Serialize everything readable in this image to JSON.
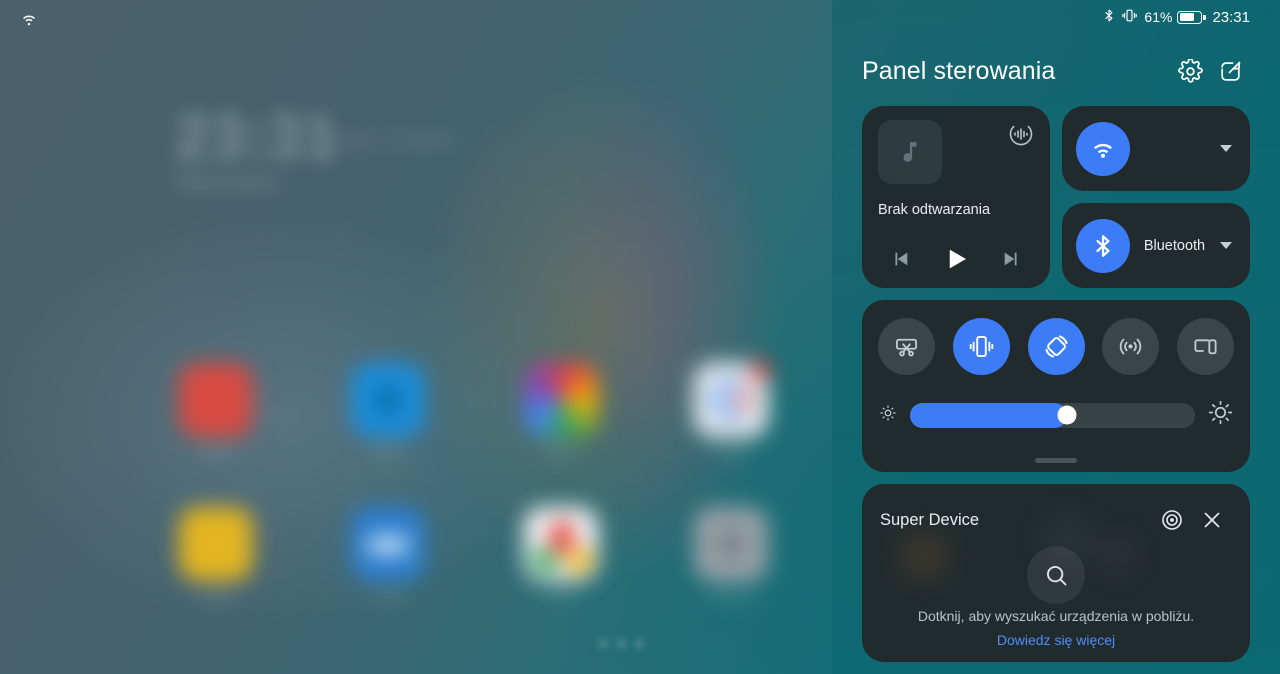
{
  "statusbar": {
    "bluetooth_icon": "bluetooth-icon",
    "vibrate_icon": "vibrate-icon",
    "battery_percent": "61%",
    "battery_level": 61,
    "clock": "23:31"
  },
  "homescreen": {
    "wifi_icon": "wifi-icon",
    "clock_big": "23:31",
    "clock_sub": "Warszawa",
    "clock_side": "środa, 6 marca",
    "apps": [
      {
        "label": "Telefon",
        "color": "#d94a42",
        "badge": false
      },
      {
        "label": "Skype",
        "color": "#1a8fdd",
        "badge": false
      },
      {
        "label": "Zdjęcia",
        "color": "#d8a020",
        "badge": false
      },
      {
        "label": "Google",
        "color": "#dedede",
        "badge": true
      },
      {
        "label": "Notatki",
        "color": "#e3b521",
        "badge": false
      },
      {
        "label": "Poczta",
        "color": "#2b7fd0",
        "badge": false
      },
      {
        "label": "Mapy",
        "color": "#ebeef0",
        "badge": false
      },
      {
        "label": "Ustawienia",
        "color": "#8b9499",
        "badge": false
      }
    ]
  },
  "panel": {
    "title": "Panel sterowania",
    "settings_icon": "gear-icon",
    "edit_icon": "edit-icon"
  },
  "media": {
    "album_art_icon": "music-note-icon",
    "cast_icon": "audio-output-icon",
    "title": "Brak odtwarzania",
    "previous_icon": "skip-previous-icon",
    "play_icon": "play-icon",
    "next_icon": "skip-next-icon"
  },
  "connectivity": [
    {
      "name": "wifi",
      "label": "",
      "icon": "wifi-icon",
      "active": true,
      "chevron_icon": "chevron-down-icon"
    },
    {
      "name": "bluetooth",
      "label": "Bluetooth",
      "icon": "bluetooth-icon",
      "active": true,
      "chevron_icon": "chevron-down-icon"
    }
  ],
  "toggles": [
    {
      "name": "screenshot",
      "icon": "screenshot-scissors-icon",
      "active": false
    },
    {
      "name": "vibrate",
      "icon": "vibrate-icon",
      "active": true
    },
    {
      "name": "rotation-lock",
      "icon": "rotation-lock-icon",
      "active": true
    },
    {
      "name": "hotspot",
      "icon": "hotspot-icon",
      "active": false
    },
    {
      "name": "screen-mirroring",
      "icon": "screen-mirroring-icon",
      "active": false
    }
  ],
  "brightness": {
    "low_icon": "brightness-low-icon",
    "high_icon": "brightness-high-icon",
    "value_percent": 55
  },
  "super_device": {
    "title": "Super Device",
    "radar_icon": "radar-icon",
    "close_icon": "close-icon",
    "search_icon": "search-icon",
    "hint": "Dotknij, aby wyszukać urządzenia w pobliżu.",
    "link": "Dowiedz się więcej"
  },
  "colors": {
    "accent_blue": "#3c7cf6",
    "card_bg": "#212b2e",
    "panel_teal": "#0d6f78",
    "link_blue": "#4e8ef8",
    "toggle_off": "#3b4548"
  }
}
